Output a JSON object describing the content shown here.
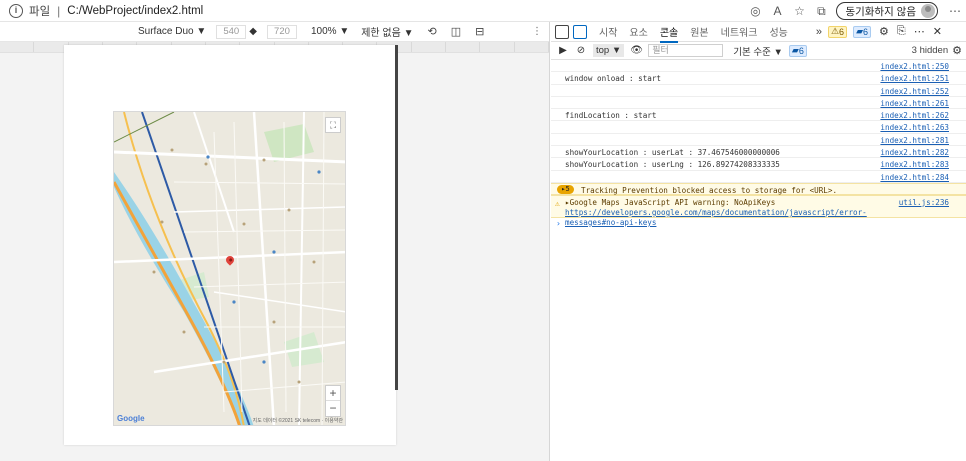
{
  "address_bar": {
    "scheme_label": "파일",
    "url": "C:/WebProject/index2.html",
    "sync_label": "동기화하지 않음"
  },
  "emulation": {
    "device": "Surface Duo ▼",
    "width": "540",
    "height": "720",
    "zoom": "100% ▼",
    "throttle": "제한 없음 ▼",
    "more": "⋮"
  },
  "map": {
    "google_logo": "Google",
    "attribution": "지도 데이터 ©2021 SK telecom · 이용약관",
    "zoom_in": "+",
    "zoom_out": "−"
  },
  "devtools": {
    "tabs": [
      "시작",
      "요소",
      "콘솔",
      "원본",
      "네트워크",
      "성능"
    ],
    "active_tab": "콘솔",
    "warning_count": "6",
    "message_count": "6",
    "context": "top ▼",
    "filter_placeholder": "필터",
    "level": "기본 수준 ▼",
    "level_count": "6",
    "hidden": "3 hidden"
  },
  "console": {
    "rows": [
      {
        "msg": "",
        "src": "index2.html:250"
      },
      {
        "msg": "window onload : start",
        "src": "index2.html:251"
      },
      {
        "msg": "",
        "src": "index2.html:252"
      },
      {
        "msg": "",
        "src": "index2.html:261"
      },
      {
        "msg": "findLocation : start",
        "src": "index2.html:262"
      },
      {
        "msg": "",
        "src": "index2.html:263"
      },
      {
        "msg": "",
        "src": "index2.html:281"
      },
      {
        "msg": "showYourLocation : userLat : 37.467546000000006",
        "src": "index2.html:282"
      },
      {
        "msg": "showYourLocation : userLng : 126.89274208333335",
        "src": "index2.html:283"
      },
      {
        "msg": "",
        "src": "index2.html:284"
      }
    ],
    "warning1": {
      "count": "5",
      "msg": "Tracking Prevention blocked access to storage for <URL>."
    },
    "warning2": {
      "msg_prefix": "▸Google Maps JavaScript API warning: NoApiKeys ",
      "link": "https://developers.google.com/maps/documentation/javascript/error-messages#no-api-keys",
      "src": "util.js:236"
    },
    "prompt": "›"
  },
  "colors": {
    "accent": "#0067c0",
    "warning_bg": "#fffbe6",
    "link": "#1a5fb4"
  }
}
